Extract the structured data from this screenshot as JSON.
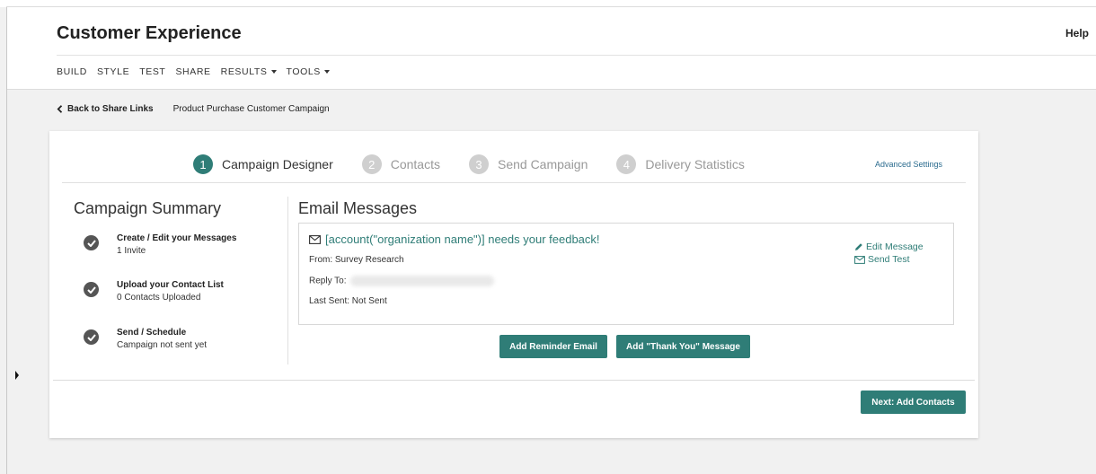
{
  "app": {
    "title": "Customer Experience",
    "help": "Help"
  },
  "nav": [
    {
      "label": "BUILD"
    },
    {
      "label": "STYLE"
    },
    {
      "label": "TEST"
    },
    {
      "label": "SHARE"
    },
    {
      "label": "RESULTS",
      "dropdown": true
    },
    {
      "label": "TOOLS",
      "dropdown": true
    }
  ],
  "breadcrumb": {
    "back": "Back to Share Links",
    "current": "Product Purchase Customer Campaign"
  },
  "steps": [
    {
      "num": "1",
      "label": "Campaign Designer",
      "active": true
    },
    {
      "num": "2",
      "label": "Contacts",
      "active": false
    },
    {
      "num": "3",
      "label": "Send Campaign",
      "active": false
    },
    {
      "num": "4",
      "label": "Delivery Statistics",
      "active": false
    }
  ],
  "advanced_settings": "Advanced Settings",
  "summary": {
    "title": "Campaign Summary",
    "items": [
      {
        "title": "Create / Edit your Messages",
        "subtitle": "1 Invite"
      },
      {
        "title": "Upload your Contact List",
        "subtitle": "0 Contacts Uploaded"
      },
      {
        "title": "Send / Schedule",
        "subtitle": "Campaign not sent yet"
      }
    ]
  },
  "email": {
    "title": "Email Messages",
    "subject": "[account(\"organization name\")] needs your feedback!",
    "from": "From: Survey Research",
    "reply_to": "Reply To:",
    "last_sent": "Last Sent: Not Sent",
    "edit": "Edit Message",
    "send_test": "Send Test"
  },
  "buttons": {
    "reminder": "Add Reminder Email",
    "thank_you": "Add \"Thank You\" Message",
    "next": "Next: Add Contacts"
  },
  "colors": {
    "accent": "#2f7d77",
    "link": "#2a6b8e"
  }
}
